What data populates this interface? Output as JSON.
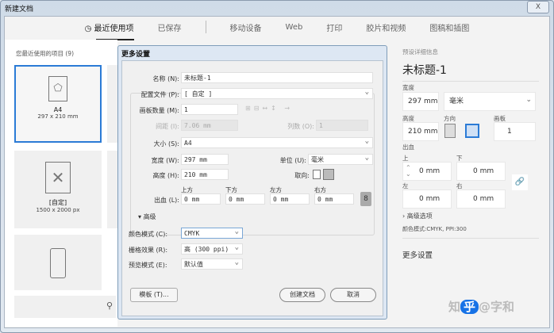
{
  "window": {
    "title": "新建文档",
    "close": "X"
  },
  "tabs": [
    {
      "label": "最近使用项"
    },
    {
      "label": "已保存"
    },
    {
      "label": "移动设备"
    },
    {
      "label": "Web"
    },
    {
      "label": "打印"
    },
    {
      "label": "胶片和视频"
    },
    {
      "label": "图稿和插图"
    }
  ],
  "recent": {
    "heading": "您最近使用的项目 (9)",
    "items": [
      {
        "name": "A4",
        "size": "297 x 210 mm"
      },
      {
        "name": "[自定]",
        "size": "1500 x 2000 px"
      }
    ]
  },
  "dialog": {
    "title": "更多设置",
    "name_label": "名称 (N):",
    "name_value": "未标题-1",
    "profile_label": "配置文件 (P):",
    "profile_value": "[ 自定 ]",
    "artboards_label": "画板数量 (M):",
    "artboards_value": "1",
    "spacing_label": "间距 (I):",
    "spacing_value": "7.06 mm",
    "columns_label": "列数 (O):",
    "columns_value": "1",
    "size_label": "大小 (S):",
    "size_value": "A4",
    "width_label": "宽度 (W):",
    "width_value": "297 mm",
    "units_label": "单位 (U):",
    "units_value": "毫米",
    "height_label": "高度 (H):",
    "height_value": "210 mm",
    "orientation_label": "取向:",
    "bleed_label": "出血 (L):",
    "bleed": [
      {
        "label": "上方",
        "value": "0 mm"
      },
      {
        "label": "下方",
        "value": "0 mm"
      },
      {
        "label": "左方",
        "value": "0 mm"
      },
      {
        "label": "右方",
        "value": "0 mm"
      }
    ],
    "advanced_label": "高级",
    "color_label": "颜色模式 (C):",
    "color_value": "CMYK",
    "raster_label": "栅格效果 (R):",
    "raster_value": "高 (300 ppi)",
    "preview_label": "预览模式 (E):",
    "preview_value": "默认值",
    "templates_btn": "模板 (T)...",
    "create_btn": "创建文档",
    "cancel_btn": "取消"
  },
  "details": {
    "heading": "预设详细信息",
    "doc_name": "未标题-1",
    "width_label": "宽度",
    "width_value": "297 mm",
    "units_value": "毫米",
    "height_label": "高度",
    "height_value": "210 mm",
    "orientation_label": "方向",
    "artboards_label": "画板",
    "artboards_value": "1",
    "bleed_label": "出血",
    "bleed": [
      {
        "label": "上",
        "value": "0 mm"
      },
      {
        "label": "下",
        "value": "0 mm"
      },
      {
        "label": "左",
        "value": "0 mm"
      },
      {
        "label": "右",
        "value": "0 mm"
      }
    ],
    "advanced_label": "高级选项",
    "advanced_summary": "颜色模式:CMYK, PPI:300",
    "more_settings": "更多设置"
  },
  "watermark": {
    "a": "知",
    "b": "乎",
    "c": "@字和"
  }
}
